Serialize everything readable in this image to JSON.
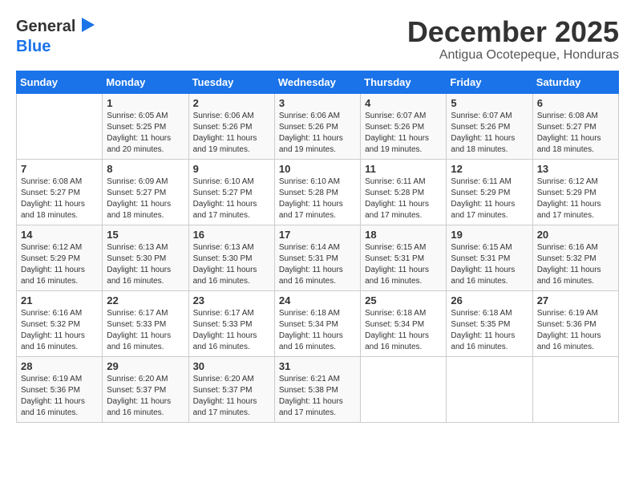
{
  "logo": {
    "general": "General",
    "blue": "Blue"
  },
  "title": "December 2025",
  "subtitle": "Antigua Ocotepeque, Honduras",
  "days_of_week": [
    "Sunday",
    "Monday",
    "Tuesday",
    "Wednesday",
    "Thursday",
    "Friday",
    "Saturday"
  ],
  "weeks": [
    [
      {
        "day": "",
        "info": ""
      },
      {
        "day": "1",
        "info": "Sunrise: 6:05 AM\nSunset: 5:25 PM\nDaylight: 11 hours\nand 20 minutes."
      },
      {
        "day": "2",
        "info": "Sunrise: 6:06 AM\nSunset: 5:26 PM\nDaylight: 11 hours\nand 19 minutes."
      },
      {
        "day": "3",
        "info": "Sunrise: 6:06 AM\nSunset: 5:26 PM\nDaylight: 11 hours\nand 19 minutes."
      },
      {
        "day": "4",
        "info": "Sunrise: 6:07 AM\nSunset: 5:26 PM\nDaylight: 11 hours\nand 19 minutes."
      },
      {
        "day": "5",
        "info": "Sunrise: 6:07 AM\nSunset: 5:26 PM\nDaylight: 11 hours\nand 18 minutes."
      },
      {
        "day": "6",
        "info": "Sunrise: 6:08 AM\nSunset: 5:27 PM\nDaylight: 11 hours\nand 18 minutes."
      }
    ],
    [
      {
        "day": "7",
        "info": "Sunrise: 6:08 AM\nSunset: 5:27 PM\nDaylight: 11 hours\nand 18 minutes."
      },
      {
        "day": "8",
        "info": "Sunrise: 6:09 AM\nSunset: 5:27 PM\nDaylight: 11 hours\nand 18 minutes."
      },
      {
        "day": "9",
        "info": "Sunrise: 6:10 AM\nSunset: 5:27 PM\nDaylight: 11 hours\nand 17 minutes."
      },
      {
        "day": "10",
        "info": "Sunrise: 6:10 AM\nSunset: 5:28 PM\nDaylight: 11 hours\nand 17 minutes."
      },
      {
        "day": "11",
        "info": "Sunrise: 6:11 AM\nSunset: 5:28 PM\nDaylight: 11 hours\nand 17 minutes."
      },
      {
        "day": "12",
        "info": "Sunrise: 6:11 AM\nSunset: 5:29 PM\nDaylight: 11 hours\nand 17 minutes."
      },
      {
        "day": "13",
        "info": "Sunrise: 6:12 AM\nSunset: 5:29 PM\nDaylight: 11 hours\nand 17 minutes."
      }
    ],
    [
      {
        "day": "14",
        "info": "Sunrise: 6:12 AM\nSunset: 5:29 PM\nDaylight: 11 hours\nand 16 minutes."
      },
      {
        "day": "15",
        "info": "Sunrise: 6:13 AM\nSunset: 5:30 PM\nDaylight: 11 hours\nand 16 minutes."
      },
      {
        "day": "16",
        "info": "Sunrise: 6:13 AM\nSunset: 5:30 PM\nDaylight: 11 hours\nand 16 minutes."
      },
      {
        "day": "17",
        "info": "Sunrise: 6:14 AM\nSunset: 5:31 PM\nDaylight: 11 hours\nand 16 minutes."
      },
      {
        "day": "18",
        "info": "Sunrise: 6:15 AM\nSunset: 5:31 PM\nDaylight: 11 hours\nand 16 minutes."
      },
      {
        "day": "19",
        "info": "Sunrise: 6:15 AM\nSunset: 5:31 PM\nDaylight: 11 hours\nand 16 minutes."
      },
      {
        "day": "20",
        "info": "Sunrise: 6:16 AM\nSunset: 5:32 PM\nDaylight: 11 hours\nand 16 minutes."
      }
    ],
    [
      {
        "day": "21",
        "info": "Sunrise: 6:16 AM\nSunset: 5:32 PM\nDaylight: 11 hours\nand 16 minutes."
      },
      {
        "day": "22",
        "info": "Sunrise: 6:17 AM\nSunset: 5:33 PM\nDaylight: 11 hours\nand 16 minutes."
      },
      {
        "day": "23",
        "info": "Sunrise: 6:17 AM\nSunset: 5:33 PM\nDaylight: 11 hours\nand 16 minutes."
      },
      {
        "day": "24",
        "info": "Sunrise: 6:18 AM\nSunset: 5:34 PM\nDaylight: 11 hours\nand 16 minutes."
      },
      {
        "day": "25",
        "info": "Sunrise: 6:18 AM\nSunset: 5:34 PM\nDaylight: 11 hours\nand 16 minutes."
      },
      {
        "day": "26",
        "info": "Sunrise: 6:18 AM\nSunset: 5:35 PM\nDaylight: 11 hours\nand 16 minutes."
      },
      {
        "day": "27",
        "info": "Sunrise: 6:19 AM\nSunset: 5:36 PM\nDaylight: 11 hours\nand 16 minutes."
      }
    ],
    [
      {
        "day": "28",
        "info": "Sunrise: 6:19 AM\nSunset: 5:36 PM\nDaylight: 11 hours\nand 16 minutes."
      },
      {
        "day": "29",
        "info": "Sunrise: 6:20 AM\nSunset: 5:37 PM\nDaylight: 11 hours\nand 16 minutes."
      },
      {
        "day": "30",
        "info": "Sunrise: 6:20 AM\nSunset: 5:37 PM\nDaylight: 11 hours\nand 17 minutes."
      },
      {
        "day": "31",
        "info": "Sunrise: 6:21 AM\nSunset: 5:38 PM\nDaylight: 11 hours\nand 17 minutes."
      },
      {
        "day": "",
        "info": ""
      },
      {
        "day": "",
        "info": ""
      },
      {
        "day": "",
        "info": ""
      }
    ]
  ]
}
